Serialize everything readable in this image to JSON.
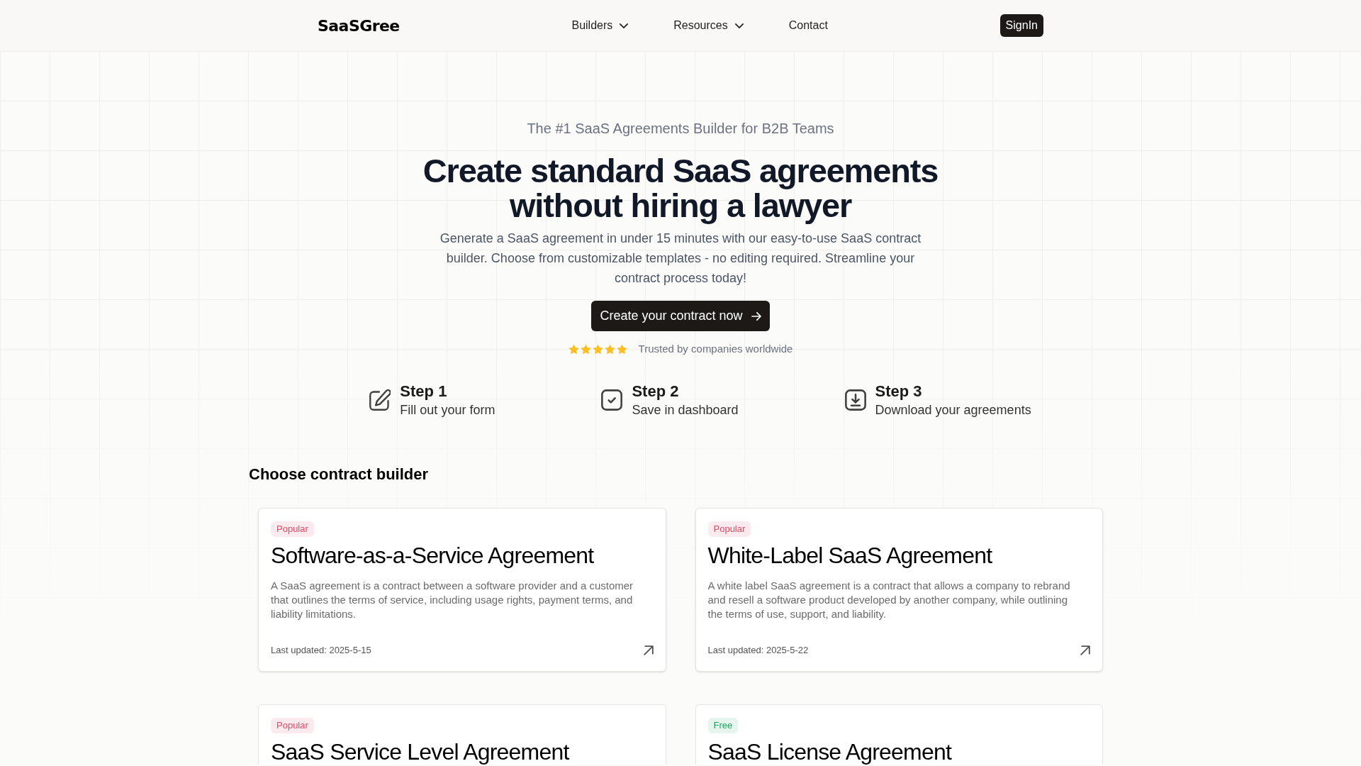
{
  "header": {
    "logo": "SaaSGree",
    "nav": [
      {
        "label": "Builders",
        "has_menu": true
      },
      {
        "label": "Resources",
        "has_menu": true
      },
      {
        "label": "Contact",
        "has_menu": false
      }
    ],
    "sign_in": "SignIn"
  },
  "hero": {
    "eyebrow": "The #1 SaaS Agreements Builder for B2B Teams",
    "headline": "Create standard SaaS agreements without hiring a lawyer",
    "description": "Generate a SaaS agreement in under 15 minutes with our easy-to-use SaaS contract builder. Choose from customizable templates - no editing required. Streamline your contract process today!",
    "cta": "Create your contract now",
    "rating": {
      "stars": 5,
      "text": "Trusted by companies worldwide"
    }
  },
  "steps": [
    {
      "kind": "edit",
      "title": "Step 1",
      "subtitle": "Fill out your form"
    },
    {
      "kind": "check",
      "title": "Step 2",
      "subtitle": "Save in dashboard"
    },
    {
      "kind": "download",
      "title": "Step 3",
      "subtitle": "Download your agreements"
    }
  ],
  "builders": {
    "title": "Choose contract builder",
    "cards": [
      {
        "badge": {
          "label": "Popular",
          "color": "#df4b68"
        },
        "title": "Software-as-a-Service Agreement",
        "description": "A SaaS agreement is a contract between a software provider and a customer that outlines the terms of service, including usage rights, payment terms, and liability limitations.",
        "updated": "Last updated: 2025-5-15"
      },
      {
        "badge": {
          "label": "Popular",
          "color": "#df4b68"
        },
        "title": "White-Label SaaS Agreement",
        "description": "A white label SaaS agreement is a contract that allows a company to rebrand and resell a software product developed by another company, while outlining the terms of use, support, and liability.",
        "updated": "Last updated: 2025-5-22"
      },
      {
        "badge": {
          "label": "Popular",
          "color": "#df4b68"
        },
        "title": "SaaS Service Level Agreement"
      },
      {
        "badge": {
          "label": "Free",
          "color": "#19a463"
        },
        "title": "SaaS License Agreement"
      }
    ]
  }
}
